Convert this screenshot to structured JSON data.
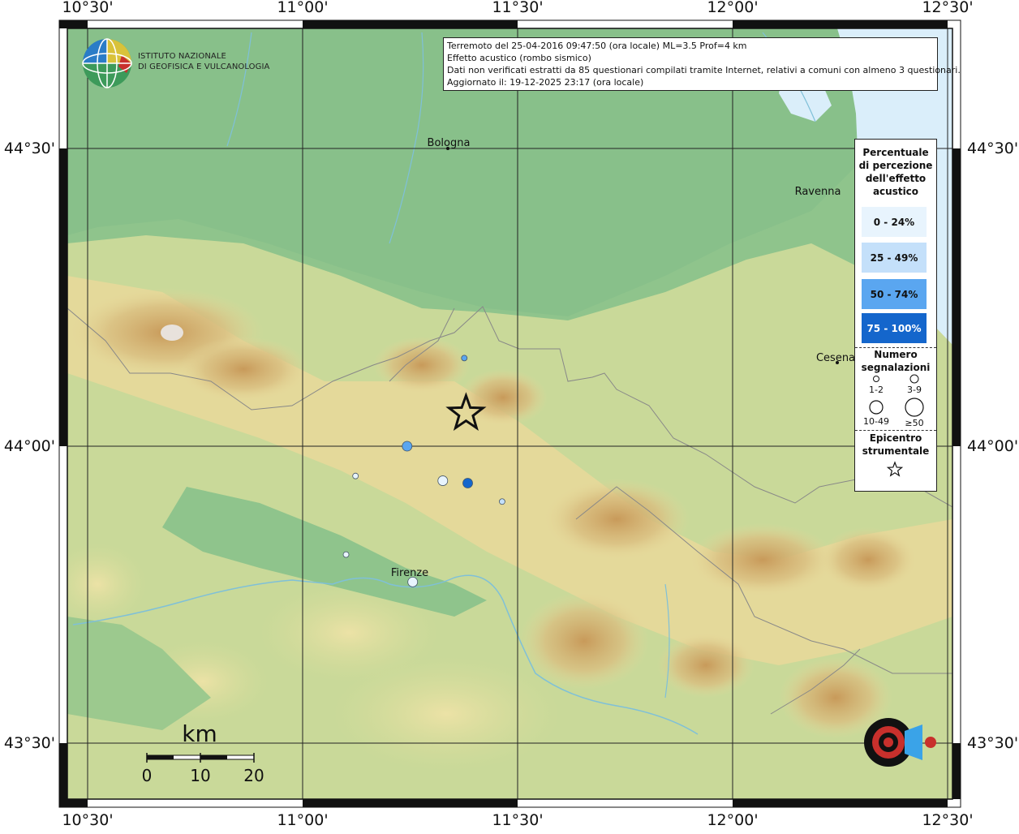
{
  "map": {
    "info": {
      "line1": "Terremoto del 25-04-2016 09:47:50 (ora locale) ML=3.5 Prof=4 km",
      "line2": "Effetto acustico (rombo sismico)",
      "line3": "Dati non verificati estratti da 85 questionari compilati tramite Internet, relativi a comuni con almeno 3 questionari.",
      "line4": "Aggiornato il: 19-12-2025 23:17 (ora locale)"
    },
    "institute": {
      "line1": "ISTITUTO NAZIONALE",
      "line2": "DI GEOFISICA E VULCANOLOGIA"
    },
    "lon_labels": [
      "10°30'",
      "11°00'",
      "11°30'",
      "12°00'",
      "12°30'"
    ],
    "lat_labels": [
      "44°30'",
      "44°00'",
      "43°30'"
    ],
    "cities": [
      {
        "name": "Bologna"
      },
      {
        "name": "Ravenna"
      },
      {
        "name": "Cesena"
      },
      {
        "name": "Firenze"
      }
    ],
    "legend": {
      "title_lines": [
        "Percentuale",
        "di percezione",
        "dell'effetto",
        "acustico"
      ],
      "classes": [
        {
          "label": "0 - 24%",
          "color": "#e8f4fd"
        },
        {
          "label": "25 - 49%",
          "color": "#c4e0fa"
        },
        {
          "label": "50 - 74%",
          "color": "#5aa6f0"
        },
        {
          "label": "75 - 100%",
          "color": "#1466cc"
        }
      ],
      "count_title_lines": [
        "Numero",
        "segnalazioni"
      ],
      "count_classes": [
        "1-2",
        "3-9",
        "10-49",
        "≥50"
      ],
      "epicenter_title_lines": [
        "Epicentro",
        "strumentale"
      ]
    },
    "scale": {
      "title": "km",
      "ticks": [
        "0",
        "10",
        "20"
      ]
    },
    "observations": [
      {
        "lon": 11.376,
        "lat": 44.148,
        "pct_class": 2,
        "count_class": 0
      },
      {
        "lon": 11.243,
        "lat": 44.0,
        "pct_class": 2,
        "count_class": 1
      },
      {
        "lon": 11.326,
        "lat": 43.942,
        "pct_class": 0,
        "count_class": 1
      },
      {
        "lon": 11.384,
        "lat": 43.938,
        "pct_class": 3,
        "count_class": 1
      },
      {
        "lon": 11.123,
        "lat": 43.95,
        "pct_class": 0,
        "count_class": 0
      },
      {
        "lon": 11.464,
        "lat": 43.907,
        "pct_class": 1,
        "count_class": 0
      },
      {
        "lon": 11.101,
        "lat": 43.818,
        "pct_class": 0,
        "count_class": 0
      },
      {
        "lon": 11.256,
        "lat": 43.772,
        "pct_class": 0,
        "count_class": 1
      }
    ],
    "epicenter": {
      "lon": 11.38,
      "lat": 44.055
    }
  }
}
